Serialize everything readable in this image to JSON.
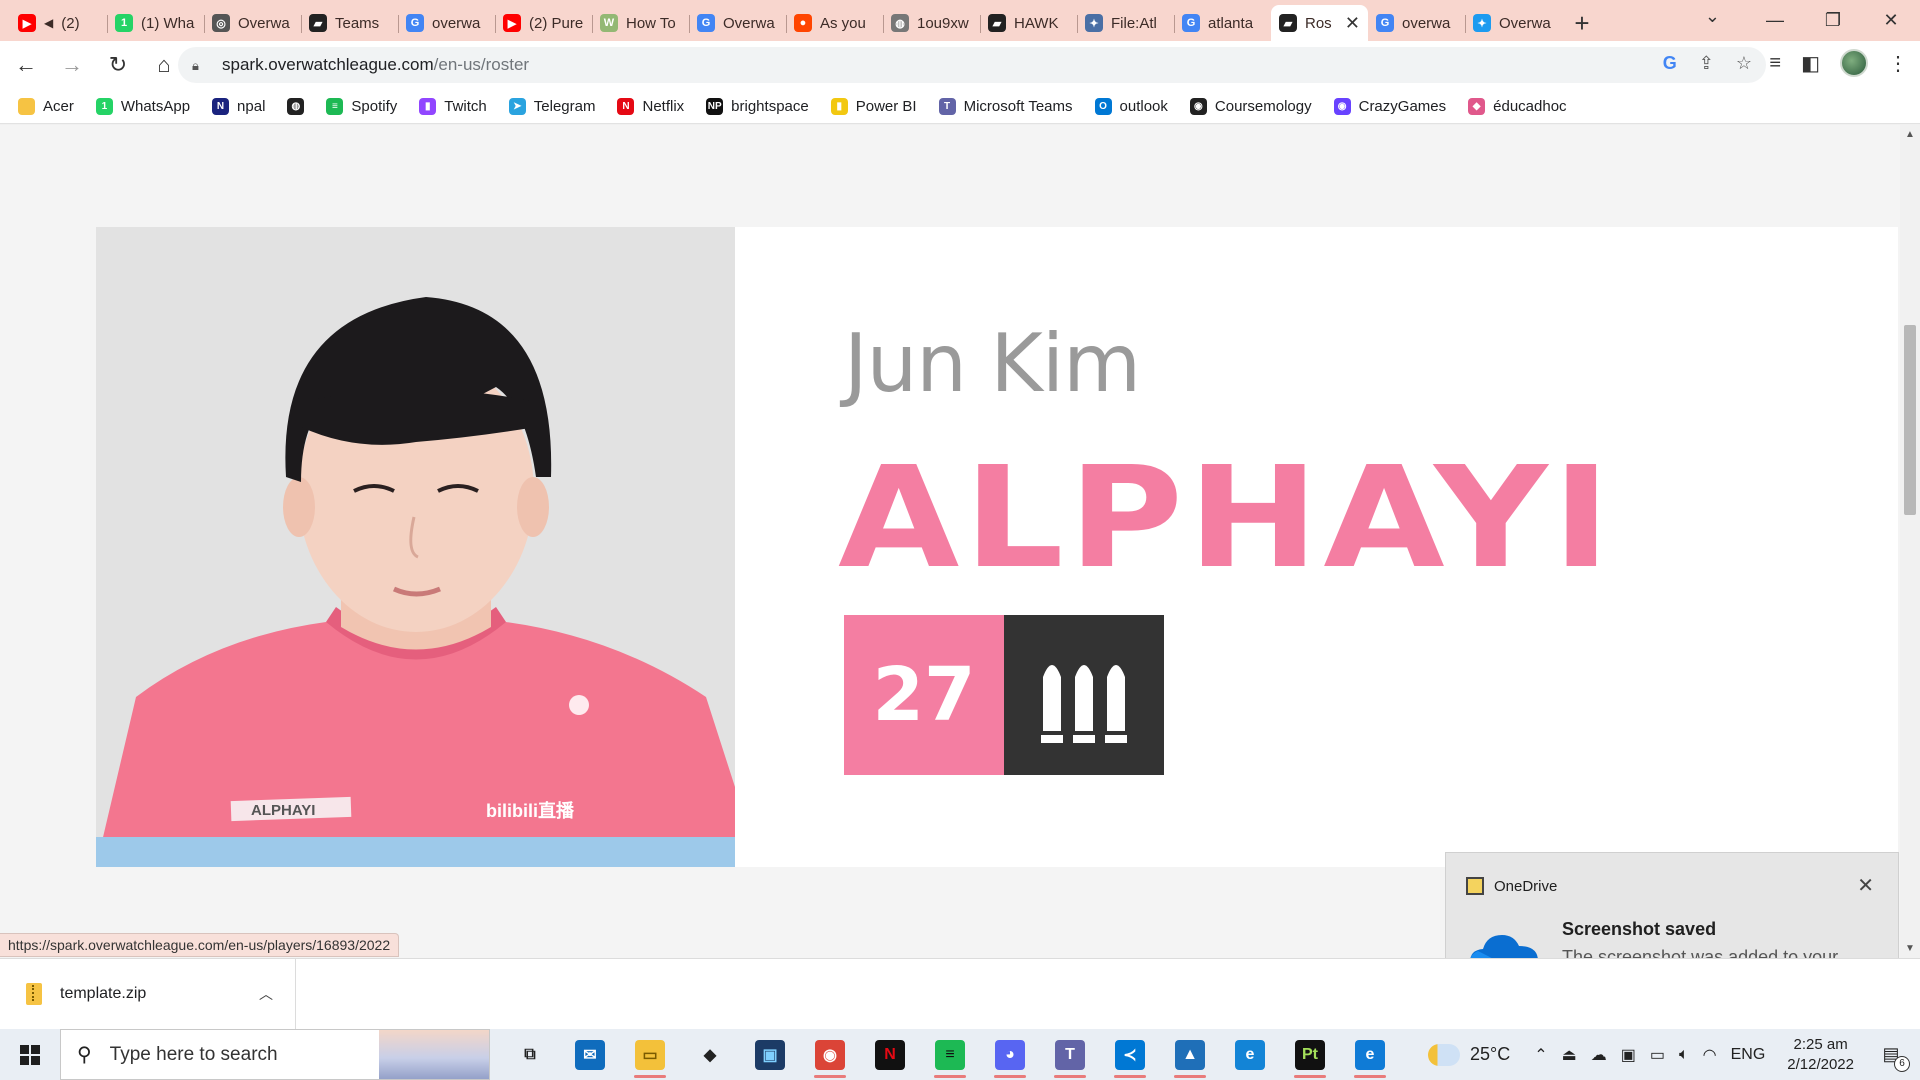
{
  "browser": {
    "tabs": [
      {
        "title": "(2)",
        "icon": "youtube-icon",
        "color": "#ff0000",
        "glyph": "▶",
        "muted": true
      },
      {
        "title": "(1) Wha",
        "icon": "whatsapp-icon",
        "color": "#25d366",
        "glyph": "1"
      },
      {
        "title": "Overwa",
        "icon": "overwatch-icon",
        "color": "#555555",
        "glyph": "◎"
      },
      {
        "title": "Teams",
        "icon": "owl-icon",
        "color": "#222222",
        "glyph": "▰"
      },
      {
        "title": "overwa",
        "icon": "google-icon",
        "color": "#4285f4",
        "glyph": "G"
      },
      {
        "title": "(2) Pure",
        "icon": "youtube-icon",
        "color": "#ff0000",
        "glyph": "▶"
      },
      {
        "title": "How To",
        "icon": "wikihow-icon",
        "color": "#93b874",
        "glyph": "W"
      },
      {
        "title": "Overwa",
        "icon": "google-icon",
        "color": "#4285f4",
        "glyph": "G"
      },
      {
        "title": "As you",
        "icon": "reddit-icon",
        "color": "#ff4500",
        "glyph": "●"
      },
      {
        "title": "1ou9xw",
        "icon": "globe-icon",
        "color": "#777777",
        "glyph": "◍"
      },
      {
        "title": "HAWK",
        "icon": "owl-icon",
        "color": "#222222",
        "glyph": "▰"
      },
      {
        "title": "File:Atl",
        "icon": "fandom-icon",
        "color": "#4a6fa5",
        "glyph": "✦"
      },
      {
        "title": "atlanta",
        "icon": "google-icon",
        "color": "#4285f4",
        "glyph": "G"
      },
      {
        "title": "Ros",
        "icon": "owl-icon",
        "color": "#222222",
        "glyph": "▰",
        "active": true
      },
      {
        "title": "overwa",
        "icon": "google-icon",
        "color": "#4285f4",
        "glyph": "G"
      },
      {
        "title": "Overwa",
        "icon": "twitter-icon",
        "color": "#1d9bf0",
        "glyph": "✦"
      }
    ],
    "url_host": "spark.overwatchleague.com",
    "url_path": "/en-us/roster",
    "bookmarks": [
      {
        "label": "Acer",
        "icon": "folder-icon",
        "color": "#f6c343",
        "glyph": ""
      },
      {
        "label": "WhatsApp",
        "icon": "whatsapp-icon",
        "color": "#25d366",
        "glyph": "1"
      },
      {
        "label": "npal",
        "icon": "npal-icon",
        "color": "#1a237e",
        "glyph": "N"
      },
      {
        "label": "",
        "icon": "globe-icon",
        "color": "#222222",
        "glyph": "◍"
      },
      {
        "label": "Spotify",
        "icon": "spotify-icon",
        "color": "#1db954",
        "glyph": "≡"
      },
      {
        "label": "Twitch",
        "icon": "twitch-icon",
        "color": "#9146ff",
        "glyph": "▮"
      },
      {
        "label": "Telegram",
        "icon": "telegram-icon",
        "color": "#2aa3df",
        "glyph": "➤"
      },
      {
        "label": "Netflix",
        "icon": "netflix-icon",
        "color": "#e50914",
        "glyph": "N"
      },
      {
        "label": "brightspace",
        "icon": "brightspace-icon",
        "color": "#111111",
        "glyph": "NP"
      },
      {
        "label": "Power BI",
        "icon": "powerbi-icon",
        "color": "#f2c811",
        "glyph": "▮"
      },
      {
        "label": "Microsoft Teams",
        "icon": "teams-icon",
        "color": "#6264a7",
        "glyph": "T"
      },
      {
        "label": "outlook",
        "icon": "outlook-icon",
        "color": "#0078d4",
        "glyph": "O"
      },
      {
        "label": "Coursemology",
        "icon": "coursemology-icon",
        "color": "#222222",
        "glyph": "◉"
      },
      {
        "label": "CrazyGames",
        "icon": "crazygames-icon",
        "color": "#6842ff",
        "glyph": "◉"
      },
      {
        "label": "éducadhoc",
        "icon": "educadhoc-icon",
        "color": "#e0588b",
        "glyph": "◆"
      }
    ]
  },
  "player": {
    "real_name": "Jun Kim",
    "handle": "ALPHAYI",
    "number": "27",
    "role_icon": "support-role-icon",
    "accent_color": "#f47ea2",
    "jersey_nameplate": "ALPHAYI",
    "jersey_sponsor": "bilibili直播"
  },
  "status_url": "https://spark.overwatchleague.com/en-us/players/16893/2022",
  "toast": {
    "app": "OneDrive",
    "title": "Screenshot saved",
    "body": "The screenshot was added to your OneDrive."
  },
  "download": {
    "filename": "template.zip"
  },
  "taskbar": {
    "search_placeholder": "Type here to search",
    "apps": [
      {
        "name": "task-view-icon",
        "color": "#e9eef4",
        "glyph": "⧉",
        "fg": "#222"
      },
      {
        "name": "mail-icon",
        "color": "#0f6cbd",
        "glyph": "✉",
        "fg": "#fff"
      },
      {
        "name": "file-explorer-icon",
        "color": "#f3c13a",
        "glyph": "▭",
        "fg": "#7a5b00",
        "running": true
      },
      {
        "name": "dropbox-icon",
        "color": "#e9eef4",
        "glyph": "◆",
        "fg": "#222"
      },
      {
        "name": "app-icon",
        "color": "#1c3b66",
        "glyph": "▣",
        "fg": "#7fd0ff"
      },
      {
        "name": "chrome-icon",
        "color": "#db4437",
        "glyph": "◉",
        "fg": "#fff",
        "running": true
      },
      {
        "name": "netflix-icon",
        "color": "#111111",
        "glyph": "N",
        "fg": "#e50914"
      },
      {
        "name": "spotify-icon",
        "color": "#1db954",
        "glyph": "≡",
        "fg": "#111",
        "running": true
      },
      {
        "name": "discord-icon",
        "color": "#5865f2",
        "glyph": "◕",
        "fg": "#fff",
        "running": true
      },
      {
        "name": "teams-icon",
        "color": "#6264a7",
        "glyph": "T",
        "fg": "#fff",
        "running": true
      },
      {
        "name": "vscode-icon",
        "color": "#0078d4",
        "glyph": "≺",
        "fg": "#fff",
        "running": true
      },
      {
        "name": "photos-icon",
        "color": "#1f6fb8",
        "glyph": "▲",
        "fg": "#fff",
        "running": true
      },
      {
        "name": "edge-icon",
        "color": "#1384d6",
        "glyph": "e",
        "fg": "#fff"
      },
      {
        "name": "pycharm-icon",
        "color": "#111111",
        "glyph": "Pt",
        "fg": "#a4e05a",
        "running": true
      },
      {
        "name": "edge-dev-icon",
        "color": "#0f7bd6",
        "glyph": "e",
        "fg": "#fff",
        "running": true
      }
    ],
    "temperature": "25°C",
    "language": "ENG",
    "time": "2:25 am",
    "date": "2/12/2022",
    "notification_count": "6"
  }
}
